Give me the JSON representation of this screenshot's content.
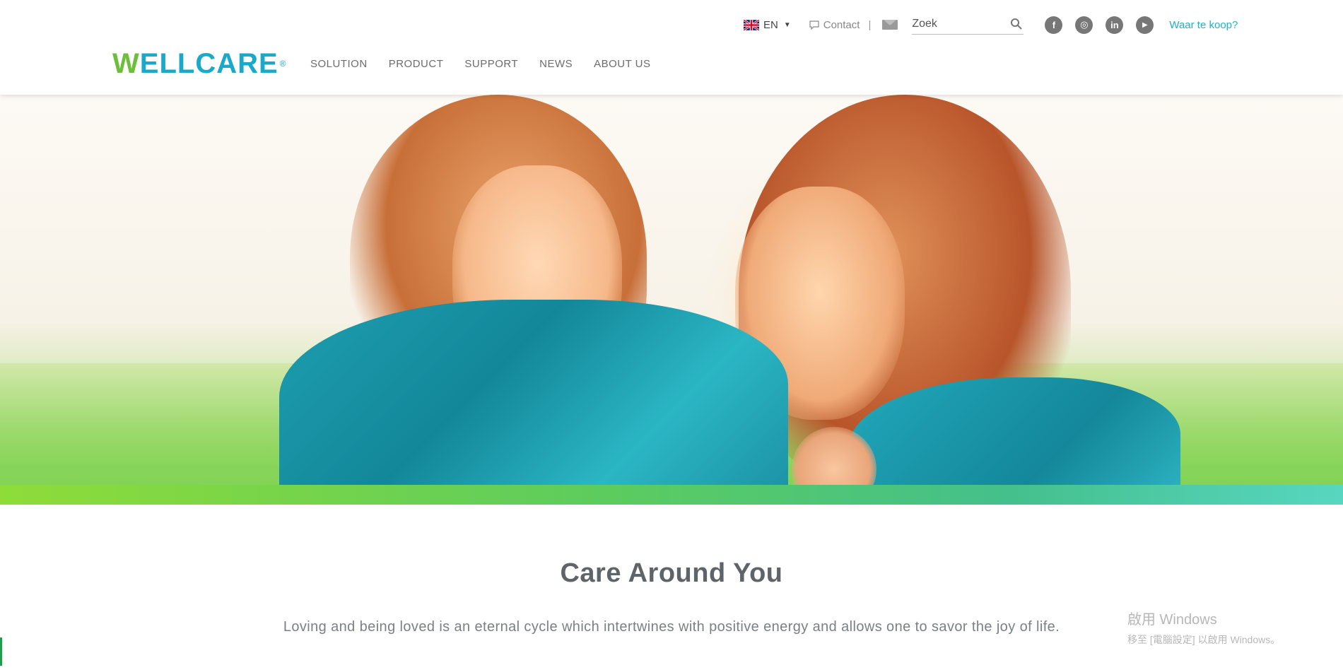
{
  "header": {
    "logo_text": "WELLCARE",
    "logo_w": "W",
    "logo_rest": "ELLCARE",
    "logo_mark": "®",
    "language": {
      "code": "EN",
      "flag": "uk-flag-icon"
    },
    "contact_label": "Contact",
    "separator": "|",
    "search": {
      "placeholder": "Zoek",
      "value": ""
    },
    "socials": [
      {
        "name": "facebook",
        "glyph": "f"
      },
      {
        "name": "instagram",
        "glyph": "◎"
      },
      {
        "name": "linkedin",
        "glyph": "in"
      },
      {
        "name": "youtube",
        "glyph": "▶"
      }
    ],
    "buy_label": "Waar te koop?",
    "nav": [
      "SOLUTION",
      "PRODUCT",
      "SUPPORT",
      "NEWS",
      "ABOUT US"
    ]
  },
  "main": {
    "title": "Care Around You",
    "lead": "Loving and being loved is an eternal cycle which intertwines with positive energy and allows one to savor the joy of life."
  },
  "watermark": {
    "line1": "啟用 Windows",
    "line2": "移至 [電腦設定] 以啟用 Windows。"
  },
  "colors": {
    "brand_teal": "#1aa9c9",
    "brand_green": "#6bbf3a",
    "link": "#18b5c9",
    "text": "#5f6469"
  }
}
